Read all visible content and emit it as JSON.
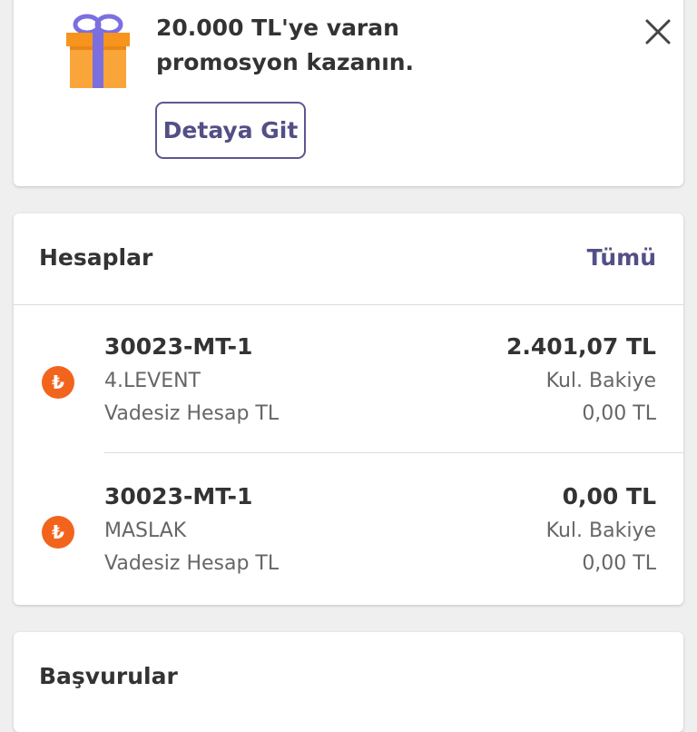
{
  "promo": {
    "line1": "20.000 TL'ye varan",
    "line2": "promosyon kazanın.",
    "button_label": "Detaya Git",
    "icon": "gift-icon",
    "close_icon": "close-icon"
  },
  "accounts": {
    "title": "Hesaplar",
    "all_label": "Tümü",
    "items": [
      {
        "currency_symbol": "₺",
        "number": "30023-MT-1",
        "branch": "4.LEVENT",
        "type": "Vadesiz Hesap TL",
        "balance": "2.401,07 TL",
        "available_label": "Kul. Bakiye",
        "available_value": "0,00 TL"
      },
      {
        "currency_symbol": "₺",
        "number": "30023-MT-1",
        "branch": "MASLAK",
        "type": "Vadesiz Hesap TL",
        "balance": "0,00 TL",
        "available_label": "Kul. Bakiye",
        "available_value": "0,00 TL"
      }
    ]
  },
  "applications": {
    "title": "Başvurular"
  },
  "colors": {
    "brand_purple": "#534f86",
    "accent_orange": "#f2641c",
    "gift_orange": "#f7941d",
    "gift_ribbon": "#7b6fe0",
    "background": "#efefef"
  }
}
